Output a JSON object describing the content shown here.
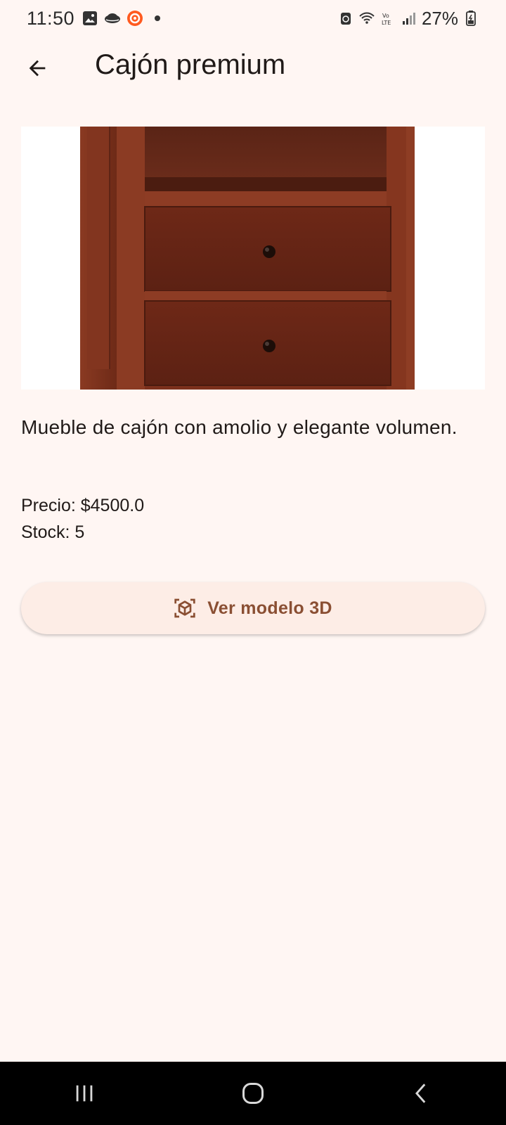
{
  "status_bar": {
    "time": "11:50",
    "battery": "27%",
    "icons": [
      "image-icon",
      "cloud-icon",
      "app-badge-icon",
      "dot-icon",
      "alarm-icon",
      "wifi-icon",
      "volte-icon",
      "signal-icon",
      "battery-icon"
    ]
  },
  "app_bar": {
    "title": "Cajón premium",
    "back_icon": "arrow-back-icon"
  },
  "product": {
    "image_alt": "Mueble de cajón de madera",
    "description": "Mueble de cajón con amolio y elegante volumen.",
    "price_text": "Precio: $4500.0",
    "stock_text": "Stock: 5"
  },
  "actions": {
    "view_3d_label": "Ver modelo 3D",
    "view_3d_icon": "view-in-ar-icon"
  },
  "nav_bar": {
    "recents_icon": "recents-icon",
    "home_icon": "home-icon",
    "back_icon": "back-nav-icon"
  },
  "colors": {
    "background": "#fff6f3",
    "button_bg": "#fdede6",
    "button_text": "#8a4f33",
    "wood": "#7a2f1c"
  }
}
